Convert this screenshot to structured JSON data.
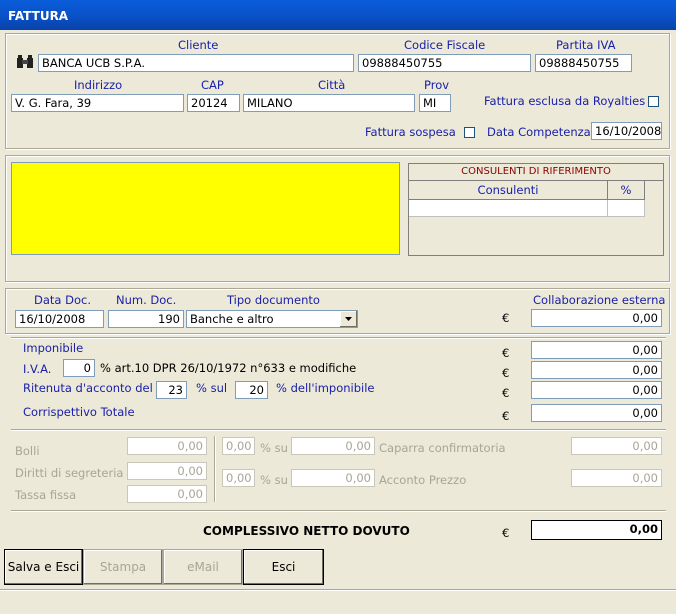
{
  "window": {
    "title": "FATTURA"
  },
  "cliente": {
    "label_cliente": "Cliente",
    "cliente": "BANCA UCB S.P.A.",
    "label_cf": "Codice Fiscale",
    "cf": "09888450755",
    "label_piva": "Partita IVA",
    "piva": "09888450755",
    "label_indirizzo": "Indirizzo",
    "indirizzo": "V. G. Fara, 39",
    "label_cap": "CAP",
    "cap": "20124",
    "label_citta": "Città",
    "citta": "MILANO",
    "label_prov": "Prov",
    "prov": "MI",
    "label_royalties": "Fattura esclusa da Royalties",
    "label_sospesa": "Fattura sospesa",
    "label_competenza": "Data Competenza",
    "competenza": "16/10/2008"
  },
  "consulenti": {
    "header": "CONSULENTI DI RIFERIMENTO",
    "col_consulenti": "Consulenti",
    "col_pct": "%",
    "note_color": "#ffff00"
  },
  "documento": {
    "label_data": "Data Doc.",
    "data": "16/10/2008",
    "label_num": "Num. Doc.",
    "num": "190",
    "label_tipo": "Tipo documento",
    "tipo": "Banche e altro",
    "label_collab": "Collaborazione esterna",
    "collab": "0,00",
    "euro": "€"
  },
  "calcolo": {
    "label_imponibile": "Imponibile",
    "imponibile": "0,00",
    "label_iva": "I.V.A.",
    "iva_pct": "0",
    "iva_text": "% art.10 DPR 26/10/1972 n°633 e modifiche",
    "iva": "0,00",
    "label_ritenuta": "Ritenuta d'acconto del",
    "ritenuta_pct": "23",
    "label_sul": "% sul",
    "ritenuta_base": "20",
    "label_dellimp": "% dell'imponibile",
    "ritenuta": "0,00",
    "label_corrisp": "Corrispettivo Totale",
    "corrisp": "0,00"
  },
  "extra": {
    "label_bolli": "Bolli",
    "bolli": "0,00",
    "label_diritti": "Diritti di segreteria",
    "diritti": "0,00",
    "label_tassa": "Tassa fissa",
    "tassa": "0,00",
    "caparra_pct": "0,00",
    "label_su": "% su",
    "caparra_base": "0,00",
    "label_caparra": "Caparra confirmatoria",
    "caparra": "0,00",
    "acconto_pct": "0,00",
    "acconto_base": "0,00",
    "label_acconto": "Acconto Prezzo",
    "acconto": "0,00"
  },
  "totale": {
    "label": "COMPLESSIVO NETTO DOVUTO",
    "value": "0,00"
  },
  "buttons": {
    "salva": "Salva e Esci",
    "stampa": "Stampa",
    "email": "eMail",
    "esci": "Esci"
  }
}
